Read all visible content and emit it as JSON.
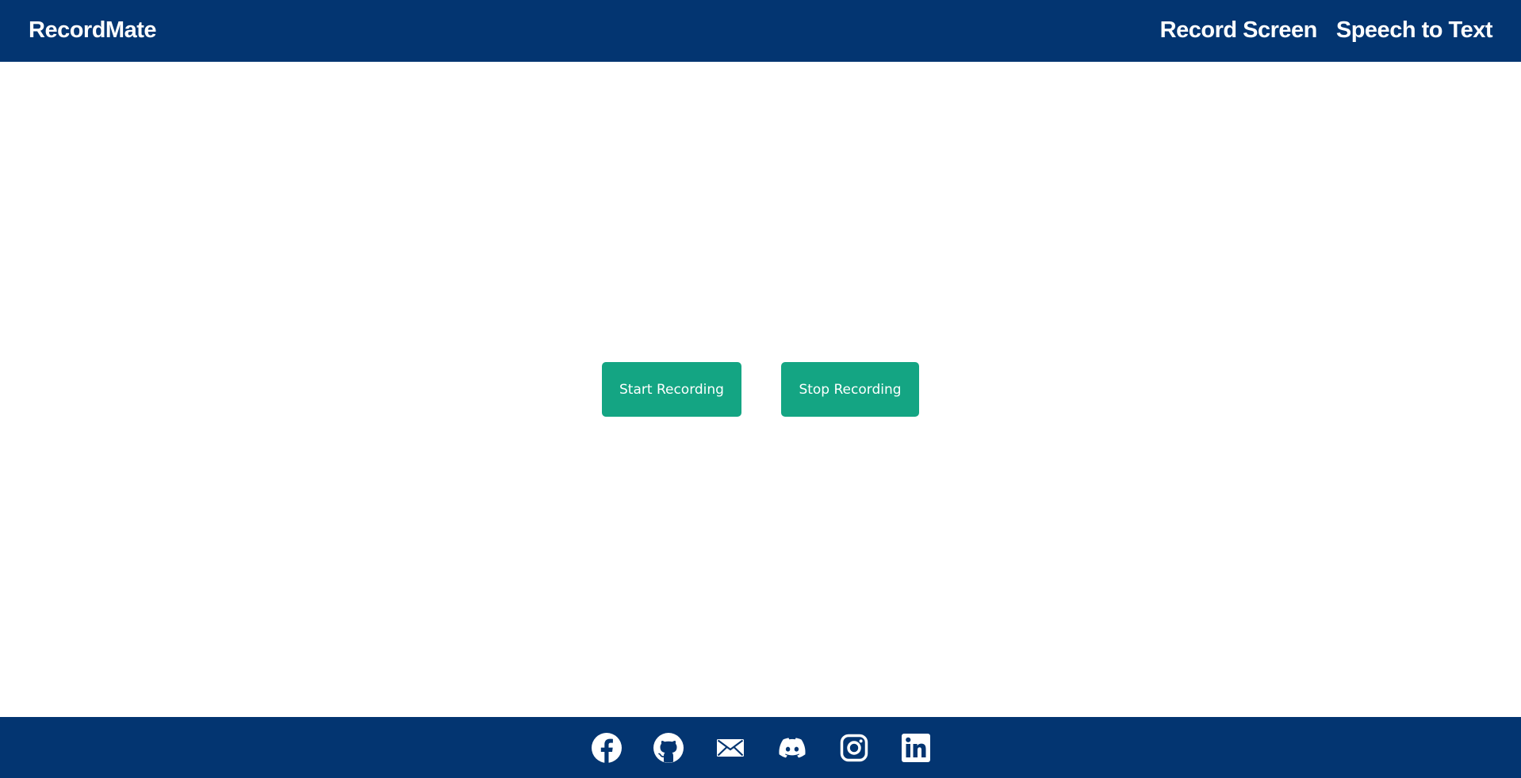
{
  "header": {
    "brand": "RecordMate",
    "nav": [
      {
        "label": "Record Screen"
      },
      {
        "label": "Speech to Text"
      }
    ]
  },
  "main": {
    "start_label": "Start Recording",
    "stop_label": "Stop Recording"
  },
  "footer": {
    "social_icons": [
      "facebook-icon",
      "github-icon",
      "mail-icon",
      "discord-icon",
      "instagram-icon",
      "linkedin-icon"
    ]
  },
  "colors": {
    "header_bg": "#033571",
    "footer_bg": "#033571",
    "button_bg": "#14a583",
    "text_light": "#ffffff"
  }
}
